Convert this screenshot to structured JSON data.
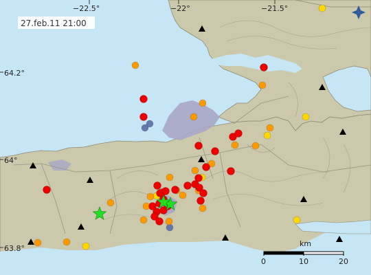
{
  "timestamp": "27.feb.11  21:00",
  "lon_labels": [
    "−22.5°",
    "−22°",
    "−21.5°"
  ],
  "lat_labels": [
    "64.2°",
    "64°",
    "63.8°"
  ],
  "scale": {
    "unit": "km",
    "ticks": [
      "0",
      "10",
      "20"
    ]
  },
  "colors": {
    "sea": "#c6e6f5",
    "land": "#cbc8ac",
    "lava": "#a8a6c6",
    "contour": "#a09a7e",
    "road": "#8a8f7a",
    "recent": "#ee0000",
    "hours": "#ff9900",
    "day": "#ffd800",
    "older": "#6677aa",
    "large": "#22dd22",
    "station": "#000000"
  },
  "legend_icon": "compass-icon",
  "stations": [
    [
      294,
      42
    ],
    [
      469,
      127
    ],
    [
      499,
      192
    ],
    [
      293,
      232
    ],
    [
      48,
      241
    ],
    [
      131,
      262
    ],
    [
      442,
      290
    ],
    [
      45,
      352
    ],
    [
      328,
      346
    ],
    [
      494,
      348
    ],
    [
      118,
      330
    ]
  ],
  "quakes": {
    "recent": [
      [
        384,
        98
      ],
      [
        209,
        144
      ],
      [
        209,
        170
      ],
      [
        289,
        212
      ],
      [
        313,
        220
      ],
      [
        339,
        199
      ],
      [
        347,
        194
      ],
      [
        300,
        243
      ],
      [
        336,
        249
      ],
      [
        68,
        276
      ],
      [
        289,
        259
      ],
      [
        284,
        268
      ],
      [
        290,
        273
      ],
      [
        296,
        281
      ],
      [
        292,
        292
      ],
      [
        273,
        270
      ],
      [
        255,
        276
      ],
      [
        233,
        281
      ],
      [
        238,
        290
      ],
      [
        232,
        296
      ],
      [
        228,
        308
      ],
      [
        225,
        315
      ],
      [
        232,
        322
      ],
      [
        238,
        306
      ],
      [
        236,
        280
      ],
      [
        241,
        278
      ],
      [
        244,
        300
      ],
      [
        222,
        300
      ],
      [
        229,
        270
      ]
    ],
    "hours": [
      [
        197,
        95
      ],
      [
        382,
        124
      ],
      [
        282,
        170
      ],
      [
        295,
        150
      ],
      [
        342,
        211
      ],
      [
        372,
        212
      ],
      [
        393,
        186
      ],
      [
        308,
        238
      ],
      [
        284,
        248
      ],
      [
        289,
        277
      ],
      [
        266,
        284
      ],
      [
        295,
        303
      ],
      [
        257,
        277
      ],
      [
        219,
        286
      ],
      [
        213,
        300
      ],
      [
        209,
        320
      ],
      [
        246,
        322
      ],
      [
        161,
        295
      ],
      [
        247,
        258
      ],
      [
        55,
        353
      ],
      [
        97,
        352
      ]
    ],
    "day": [
      [
        469,
        12
      ],
      [
        445,
        170
      ],
      [
        389,
        197
      ],
      [
        294,
        258
      ],
      [
        432,
        320
      ],
      [
        125,
        358
      ],
      [
        228,
        285
      ]
    ],
    "older": [
      [
        218,
        180
      ],
      [
        211,
        186
      ],
      [
        247,
        331
      ]
    ],
    "large": [
      [
        145,
        311
      ],
      [
        248,
        297
      ],
      [
        238,
        294
      ]
    ]
  }
}
